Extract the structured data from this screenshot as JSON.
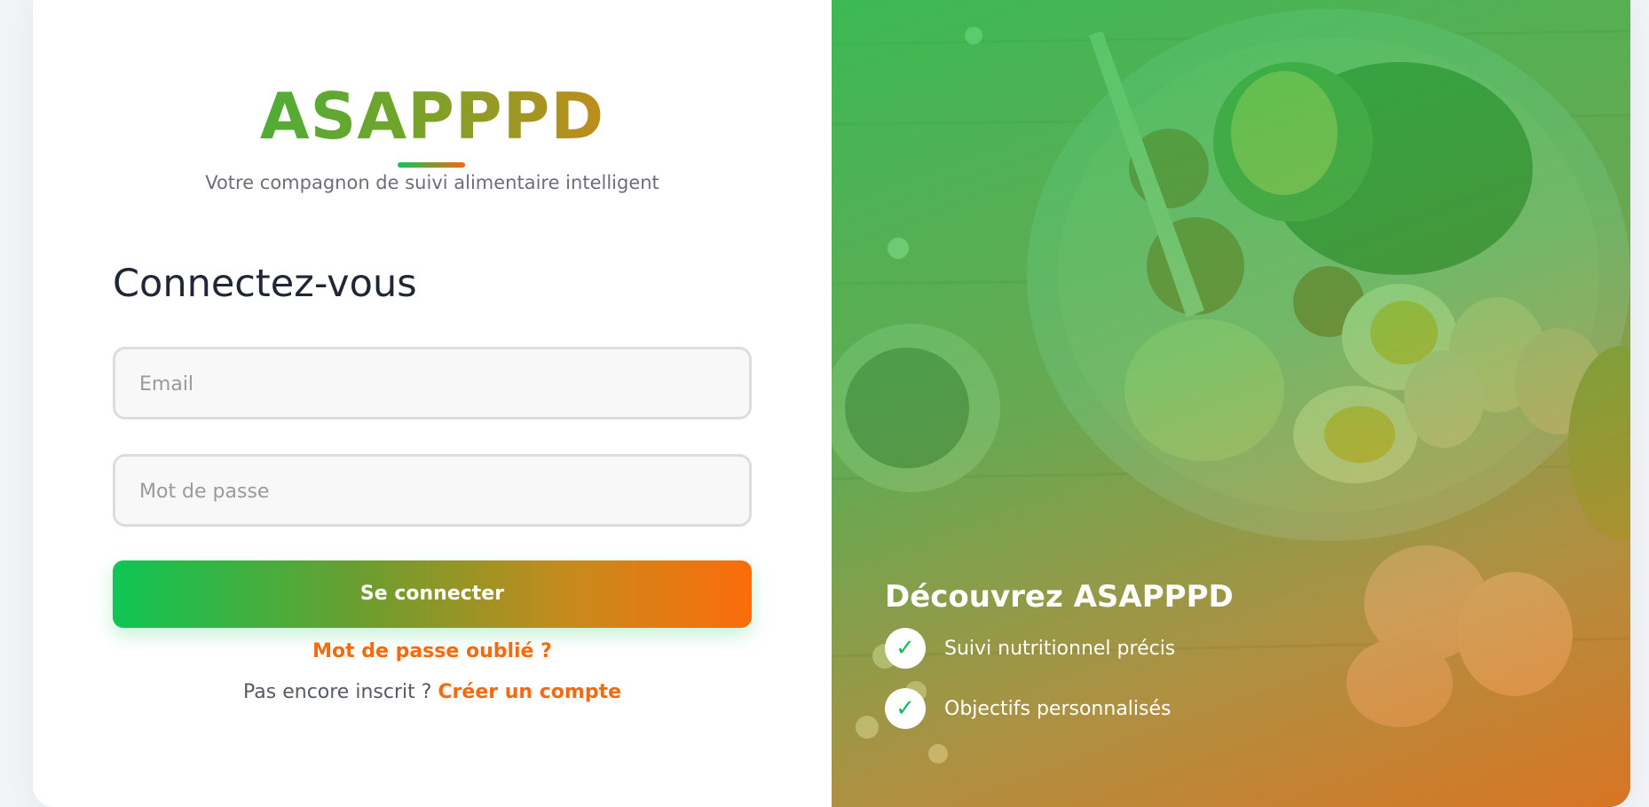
{
  "brand": {
    "name": "ASAPPPD",
    "tagline": "Votre compagnon de suivi alimentaire intelligent"
  },
  "login": {
    "heading": "Connectez-vous",
    "email_placeholder": "Email",
    "password_placeholder": "Mot de passe",
    "submit_label": "Se connecter",
    "forgot_link": "Mot de passe oublié ?",
    "signup_prompt": "Pas encore inscrit ?",
    "signup_link": "Créer un compte"
  },
  "promo": {
    "title": "Découvrez ASAPPPD",
    "features": [
      {
        "icon": "check-icon",
        "label": "Suivi nutritionnel précis"
      },
      {
        "icon": "check-icon",
        "label": "Objectifs personnalisés"
      }
    ]
  },
  "colors": {
    "accent_green": "#10c45a",
    "accent_orange": "#f56a0c",
    "heading_text": "#1e2733"
  }
}
